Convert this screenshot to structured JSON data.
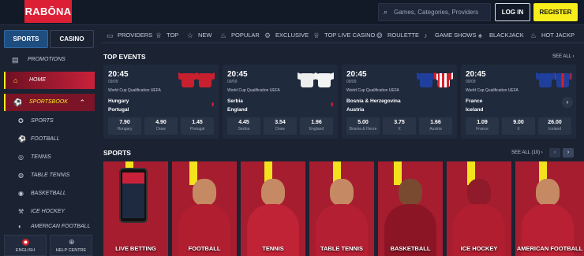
{
  "header": {
    "logo": "RABŌNA",
    "search_placeholder": "Games, Categories, Providers",
    "login": "LOG IN",
    "register": "REGISTER"
  },
  "sidebar": {
    "tabs": [
      "SPORTS",
      "CASINO"
    ],
    "items": [
      {
        "label": "Promotions",
        "icon": "gift-icon"
      },
      {
        "label": "Home",
        "icon": "home-icon"
      },
      {
        "label": "Sportsbook",
        "icon": "sportsbook-icon"
      },
      {
        "label": "Sports",
        "icon": "sports-icon"
      },
      {
        "label": "Football",
        "icon": "football-icon"
      },
      {
        "label": "Tennis",
        "icon": "tennis-icon"
      },
      {
        "label": "Table Tennis",
        "icon": "table-tennis-icon"
      },
      {
        "label": "Basketball",
        "icon": "basketball-icon"
      },
      {
        "label": "Ice Hockey",
        "icon": "ice-hockey-icon"
      },
      {
        "label": "American Football",
        "icon": "american-football-icon"
      }
    ],
    "language": "ENGLISH",
    "help": "HELP CENTRE"
  },
  "categories": [
    "PROVIDERS",
    "TOP",
    "NEW",
    "POPULAR",
    "EXCLUSIVE",
    "TOP LIVE CASINO",
    "ROULETTE",
    "GAME SHOWS",
    "BLACKJACK",
    "HOT JACKP"
  ],
  "top_events": {
    "title": "TOP EVENTS",
    "see_all": "SEE ALL",
    "events": [
      {
        "time": "20:45",
        "date": "09/09",
        "competition": "World Cup Qualification UEFA",
        "home": "Hungary",
        "away": "Portugal",
        "odds": [
          {
            "v": "7.90",
            "l": "Hungary"
          },
          {
            "v": "4.90",
            "l": "Draw"
          },
          {
            "v": "1.45",
            "l": "Portugal"
          }
        ]
      },
      {
        "time": "20:45",
        "date": "09/09",
        "competition": "World Cup Qualification UEFA",
        "home": "Serbia",
        "away": "England",
        "odds": [
          {
            "v": "4.45",
            "l": "Serbia"
          },
          {
            "v": "3.54",
            "l": "Draw"
          },
          {
            "v": "1.96",
            "l": "England"
          }
        ]
      },
      {
        "time": "20:45",
        "date": "09/09",
        "competition": "World Cup Qualification UEFA",
        "home": "Bosnia & Herzegovina",
        "away": "Austria",
        "odds": [
          {
            "v": "5.00",
            "l": "Bosnia & Herze"
          },
          {
            "v": "3.75",
            "l": "X"
          },
          {
            "v": "1.66",
            "l": "Austria"
          }
        ]
      },
      {
        "time": "20:45",
        "date": "09/09",
        "competition": "World Cup Qualification UEFA",
        "home": "France",
        "away": "Iceland",
        "odds": [
          {
            "v": "1.09",
            "l": "France"
          },
          {
            "v": "9.00",
            "l": "X"
          },
          {
            "v": "26.00",
            "l": "Iceland"
          }
        ]
      }
    ]
  },
  "sports": {
    "title": "SPORTS",
    "see_all": "SEE ALL (10)",
    "tiles": [
      "LIVE BETTING",
      "FOOTBALL",
      "TENNIS",
      "TABLE TENNIS",
      "BASKETBALL",
      "ICE HOCKEY",
      "AMERICAN FOOTBALL"
    ]
  },
  "colors": {
    "accent": "#f7ee1c",
    "brand": "#dd1f36",
    "bg": "#1b2333"
  }
}
